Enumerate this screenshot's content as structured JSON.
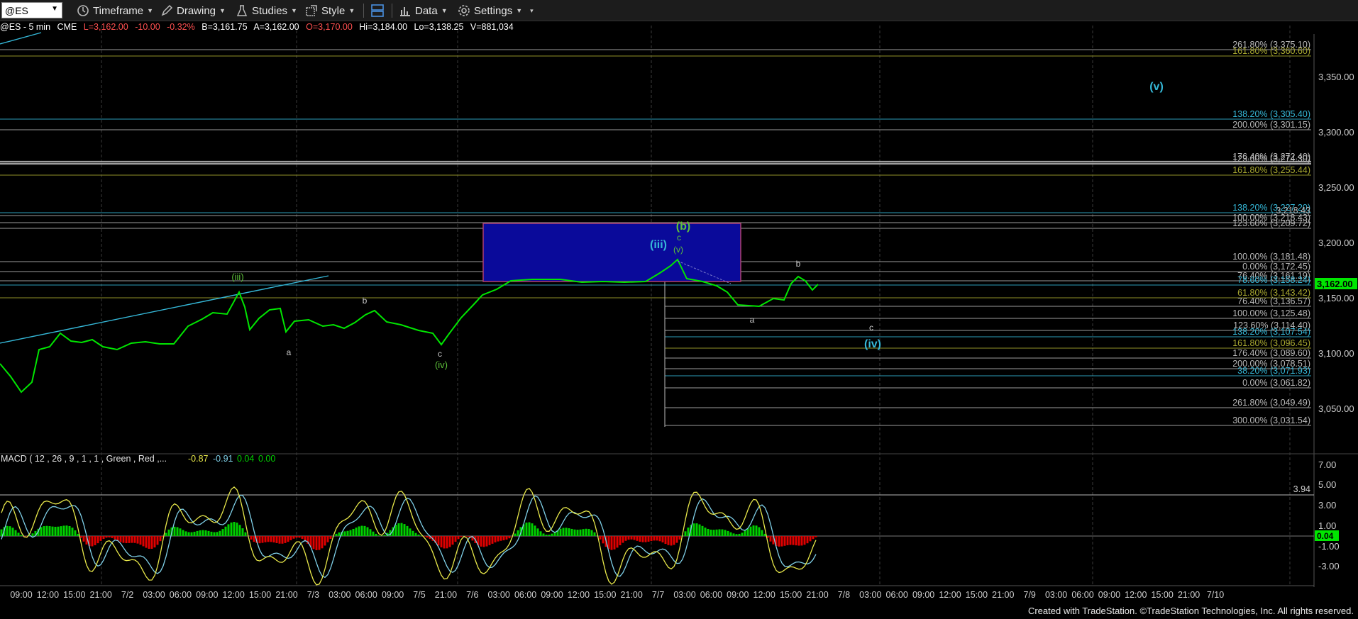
{
  "toolbar": {
    "symbol": "@ES",
    "timeframe": "Timeframe",
    "drawing": "Drawing",
    "studies": "Studies",
    "style": "Style",
    "data": "Data",
    "settings": "Settings"
  },
  "info": {
    "symbol": "@ES - 5 min",
    "exchange": "CME",
    "last": "L=3,162.00",
    "chg": "-10.00",
    "pct": "-0.32%",
    "bid": "B=3,161.75",
    "ask": "A=3,162.00",
    "open": "O=3,170.00",
    "high": "Hi=3,184.00",
    "low": "Lo=3,138.25",
    "volume": "V=881,034"
  },
  "colors": {
    "price": "#00e600",
    "macd_line": "#e8e84a",
    "signal_line": "#7fd0e8",
    "hist_pos": "#00d000",
    "hist_neg": "#e00000",
    "box": "#0a0a9a",
    "cyan": "#35b8d8"
  },
  "price_axis": {
    "ticks": [
      "3,350.00",
      "3,300.00",
      "3,250.00",
      "3,200.00",
      "3,150.00",
      "3,100.00",
      "3,050.00"
    ],
    "current": "3,162.00"
  },
  "macd": {
    "label": "MACD ( 12 , 26 , 9 , 1 , 1 , Green , Red ,...",
    "v1": "-0.87",
    "v2": "-0.91",
    "v3": "0.04",
    "v4": "0.00",
    "ticks": [
      "7.00",
      "5.00",
      "3.00",
      "1.00",
      "-1.00",
      "-3.00"
    ],
    "level": "3.94",
    "current": "0.04"
  },
  "time_axis": [
    "09:00",
    "12:00",
    "15:00",
    "21:00",
    "7/2",
    "03:00",
    "06:00",
    "09:00",
    "12:00",
    "15:00",
    "21:00",
    "7/3",
    "03:00",
    "06:00",
    "09:00",
    "7/5",
    "21:00",
    "7/6",
    "03:00",
    "06:00",
    "09:00",
    "12:00",
    "15:00",
    "21:00",
    "7/7",
    "03:00",
    "06:00",
    "09:00",
    "12:00",
    "15:00",
    "21:00",
    "7/8",
    "03:00",
    "06:00",
    "09:00",
    "12:00",
    "15:00",
    "21:00",
    "7/9",
    "03:00",
    "06:00",
    "09:00",
    "12:00",
    "15:00",
    "21:00",
    "7/10"
  ],
  "fib_levels": [
    {
      "text": "261.80% (3,375.10)",
      "color": "#b8b8b8"
    },
    {
      "text": "161.80% (3,360.60)",
      "color": "#a8a830"
    },
    {
      "text": "138.20% (3,305.40)",
      "color": "#35b8d8"
    },
    {
      "text": "200.00% (3,301.15)",
      "color": "#b8b8b8"
    },
    {
      "text": "176.40% (3,272.40)",
      "color": "#b8b8b8"
    },
    {
      "text": "123.60% (3,274.30)",
      "color": "#b8b8b8"
    },
    {
      "text": "161.80% (3,255.44)",
      "color": "#a8a830"
    },
    {
      "text": "138.20% (3,227.20)",
      "color": "#35b8d8"
    },
    {
      "text": "3,218.43",
      "color": "#b8b8b8"
    },
    {
      "text": "100.00% (3,218.43)",
      "color": "#b8b8b8"
    },
    {
      "text": "123.60% (3,209.72)",
      "color": "#b8b8b8"
    },
    {
      "text": "100.00% (3,181.48)",
      "color": "#b8b8b8"
    },
    {
      "text": "0.00% (3,172.45)",
      "color": "#b8b8b8"
    },
    {
      "text": "76.40% (3,161.19)",
      "color": "#b8b8b8"
    },
    {
      "text": "78.60% (3,158.24)",
      "color": "#35b8d8"
    },
    {
      "text": "61.80% (3,143.42)",
      "color": "#a8a830"
    },
    {
      "text": "76.40% (3,136.57)",
      "color": "#b8b8b8"
    },
    {
      "text": "100.00% (3,125.48)",
      "color": "#b8b8b8"
    },
    {
      "text": "123.60% (3,114.40)",
      "color": "#b8b8b8"
    },
    {
      "text": "138.20% (3,107.54)",
      "color": "#35b8d8"
    },
    {
      "text": "161.80% (3,096.45)",
      "color": "#a8a830"
    },
    {
      "text": "176.40% (3,089.60)",
      "color": "#b8b8b8"
    },
    {
      "text": "200.00% (3,078.51)",
      "color": "#b8b8b8"
    },
    {
      "text": "38.20% (3,071.93)",
      "color": "#35b8d8"
    },
    {
      "text": "0.00% (3,061.82)",
      "color": "#b8b8b8"
    },
    {
      "text": "261.80% (3,049.49)",
      "color": "#b8b8b8"
    },
    {
      "text": "300.00% (3,031.54)",
      "color": "#b8b8b8"
    }
  ],
  "wave_labels": [
    {
      "text": "(iii)",
      "color": "#5ec23a"
    },
    {
      "text": "a",
      "color": "#c8c8c8"
    },
    {
      "text": "b",
      "color": "#c8c8c8"
    },
    {
      "text": "c",
      "color": "#c8c8c8"
    },
    {
      "text": "(iv)",
      "color": "#5ec23a"
    },
    {
      "text": "(iii)",
      "color": "#35b8d8"
    },
    {
      "text": "(b)",
      "color": "#5ec23a"
    },
    {
      "text": "c",
      "color": "#5ec23a"
    },
    {
      "text": "(v)",
      "color": "#5ec23a"
    },
    {
      "text": "a",
      "color": "#c8c8c8"
    },
    {
      "text": "b",
      "color": "#c8c8c8"
    },
    {
      "text": "c",
      "color": "#c8c8c8"
    },
    {
      "text": "(iv)",
      "color": "#35b8d8"
    },
    {
      "text": "(v)",
      "color": "#35b8d8"
    }
  ],
  "footer": "Created with TradeStation. ©TradeStation Technologies, Inc. All rights reserved."
}
